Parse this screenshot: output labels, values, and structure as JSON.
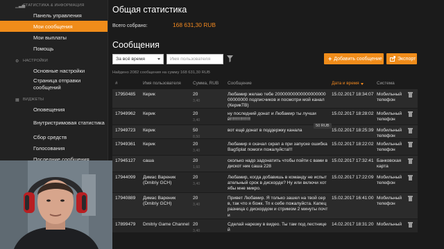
{
  "sidebar": {
    "sections": [
      {
        "title": "СТАТИСТИКА & ИНФОРМАЦИЯ",
        "icon": "chart-icon",
        "items": [
          {
            "label": "Панель управления",
            "active": false
          },
          {
            "label": "Мои сообщения",
            "active": true
          },
          {
            "label": "Мои выплаты",
            "active": false
          },
          {
            "label": "Помощь",
            "active": false
          }
        ]
      },
      {
        "title": "НАСТРОЙКИ",
        "icon": "gear-icon",
        "items": [
          {
            "label": "Основные настройки",
            "active": false
          },
          {
            "label": "Страница отправки сообщений",
            "active": false
          }
        ]
      },
      {
        "title": "ВИДЖЕТЫ",
        "icon": "widget-icon",
        "items": [
          {
            "label": "Оповещения",
            "active": false
          },
          {
            "label": "Внутристримовая статистика",
            "active": false
          },
          {
            "label": "Сбор средств",
            "active": false
          },
          {
            "label": "Голосования",
            "active": false
          },
          {
            "label": "Последние сообщения",
            "active": false
          }
        ]
      }
    ]
  },
  "stats": {
    "title": "Общая статистика",
    "total_label": "Всего собрано:",
    "total_value": "168 631,30 RUB"
  },
  "messages": {
    "title": "Сообщения",
    "period_select": "За всё время",
    "user_placeholder": "Имя пользователя",
    "add_button": "Добавить сообщение",
    "export_button": "Экспорт",
    "found_text": "Найдено 2082 сообщения на сумму 168 631,30 RUB",
    "tooltip": "50 RUB"
  },
  "table": {
    "headers": [
      "#",
      "Имя пользователя",
      "Сумма, RUB",
      "Сообщение",
      "Дата и время",
      "Система"
    ],
    "rows": [
      {
        "id": "17950485",
        "user": "Керик",
        "sum": "20",
        "net": "3,40",
        "message": "Любамир желаю тебе 2000000000000000000000000000 подписчиков и посмотри мой канал (КерикТВ)",
        "date": "15.02.2017 18:34:07",
        "system": "Мобильный телефон"
      },
      {
        "id": "17949962",
        "user": "Керик",
        "sum": "20",
        "net": "3,40",
        "message": "ну последний донат и Любамир ты лучший!!!!!!!!!!!!!!!!",
        "date": "15.02.2017 18:28:02",
        "system": "Мобильный телефон"
      },
      {
        "id": "17949723",
        "user": "Керик",
        "sum": "50",
        "net": "8,50",
        "message": "вот ещё донат в поддержку канала",
        "date": "15.02.2017 18:25:39",
        "system": "Мобильный телефон"
      },
      {
        "id": "17949361",
        "user": "Керик",
        "sum": "20",
        "net": "3,40",
        "message": "Любамир я скачал скрап а при запуске ошибка BagSplat помоги пожалуйста!!!",
        "date": "15.02.2017 18:22:02",
        "system": "Мобильный телефон"
      },
      {
        "id": "17945127",
        "user": "саша",
        "sum": "20",
        "net": "1,60",
        "message": "сколько надо задонатить чтобы пойти с вами в дискот ник саша 228",
        "date": "15.02.2017 17:32:41",
        "system": "Банковская карта"
      },
      {
        "id": "17944099",
        "user": "Димас Вареник (Dmitriy GCH)",
        "sum": "20",
        "net": "3,40",
        "message": "Любамир, когда добавишь в команду не испытательный срок в дискорде? Ну или включи хотябы мне микро.",
        "date": "15.02.2017 17:22:09",
        "system": "Мобильный телефон"
      },
      {
        "id": "17940889",
        "user": "Димас Вареник (Dmitriy GCH)",
        "sum": "20",
        "net": "3,40",
        "message": "Привет Любамир. Я только зашел на твой серв, так что я божк. Тп к себе пожалуйста. Капец разница с дискордом и стримом 2 минуты почти",
        "date": "15.02.2017 16:41:00",
        "system": "Мобильный телефон"
      },
      {
        "id": "17899479",
        "user": "Dmitriy Game Channel",
        "sum": "20",
        "net": "3,40",
        "message": "Сделай нарезку в видео. Ты там под лестницей",
        "date": "14.02.2017 18:31:20",
        "system": "Мобильный"
      }
    ]
  }
}
